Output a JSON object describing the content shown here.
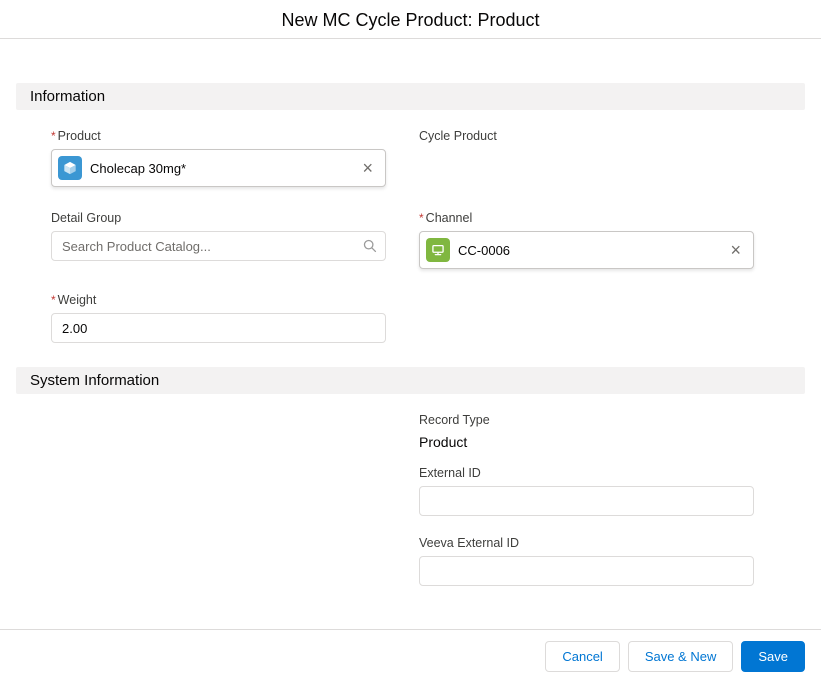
{
  "modal": {
    "title": "New MC Cycle Product: Product"
  },
  "sections": {
    "information": {
      "title": "Information"
    },
    "system": {
      "title": "System Information"
    }
  },
  "required_marker": "*",
  "fields": {
    "product": {
      "label": "Product",
      "required": true,
      "value": "Cholecap 30mg*",
      "icon": "product-icon",
      "clear": "×"
    },
    "cycle_product": {
      "label": "Cycle Product"
    },
    "detail_group": {
      "label": "Detail Group",
      "placeholder": "Search Product Catalog..."
    },
    "channel": {
      "label": "Channel",
      "required": true,
      "value": "CC-0006",
      "icon": "channel-icon",
      "clear": "×"
    },
    "weight": {
      "label": "Weight",
      "required": true,
      "value": "2.00"
    },
    "record_type": {
      "label": "Record Type",
      "value": "Product"
    },
    "external_id": {
      "label": "External ID",
      "value": ""
    },
    "veeva_external_id": {
      "label": "Veeva External ID",
      "value": ""
    }
  },
  "footer": {
    "cancel_label": "Cancel",
    "save_new_label": "Save & New",
    "save_label": "Save"
  },
  "colors": {
    "accent": "#0176d3",
    "required": "#c23934",
    "product_icon_bg": "#3b97d3",
    "channel_icon_bg": "#80b740",
    "section_bg": "#f3f2f2",
    "border": "#dddbda"
  }
}
